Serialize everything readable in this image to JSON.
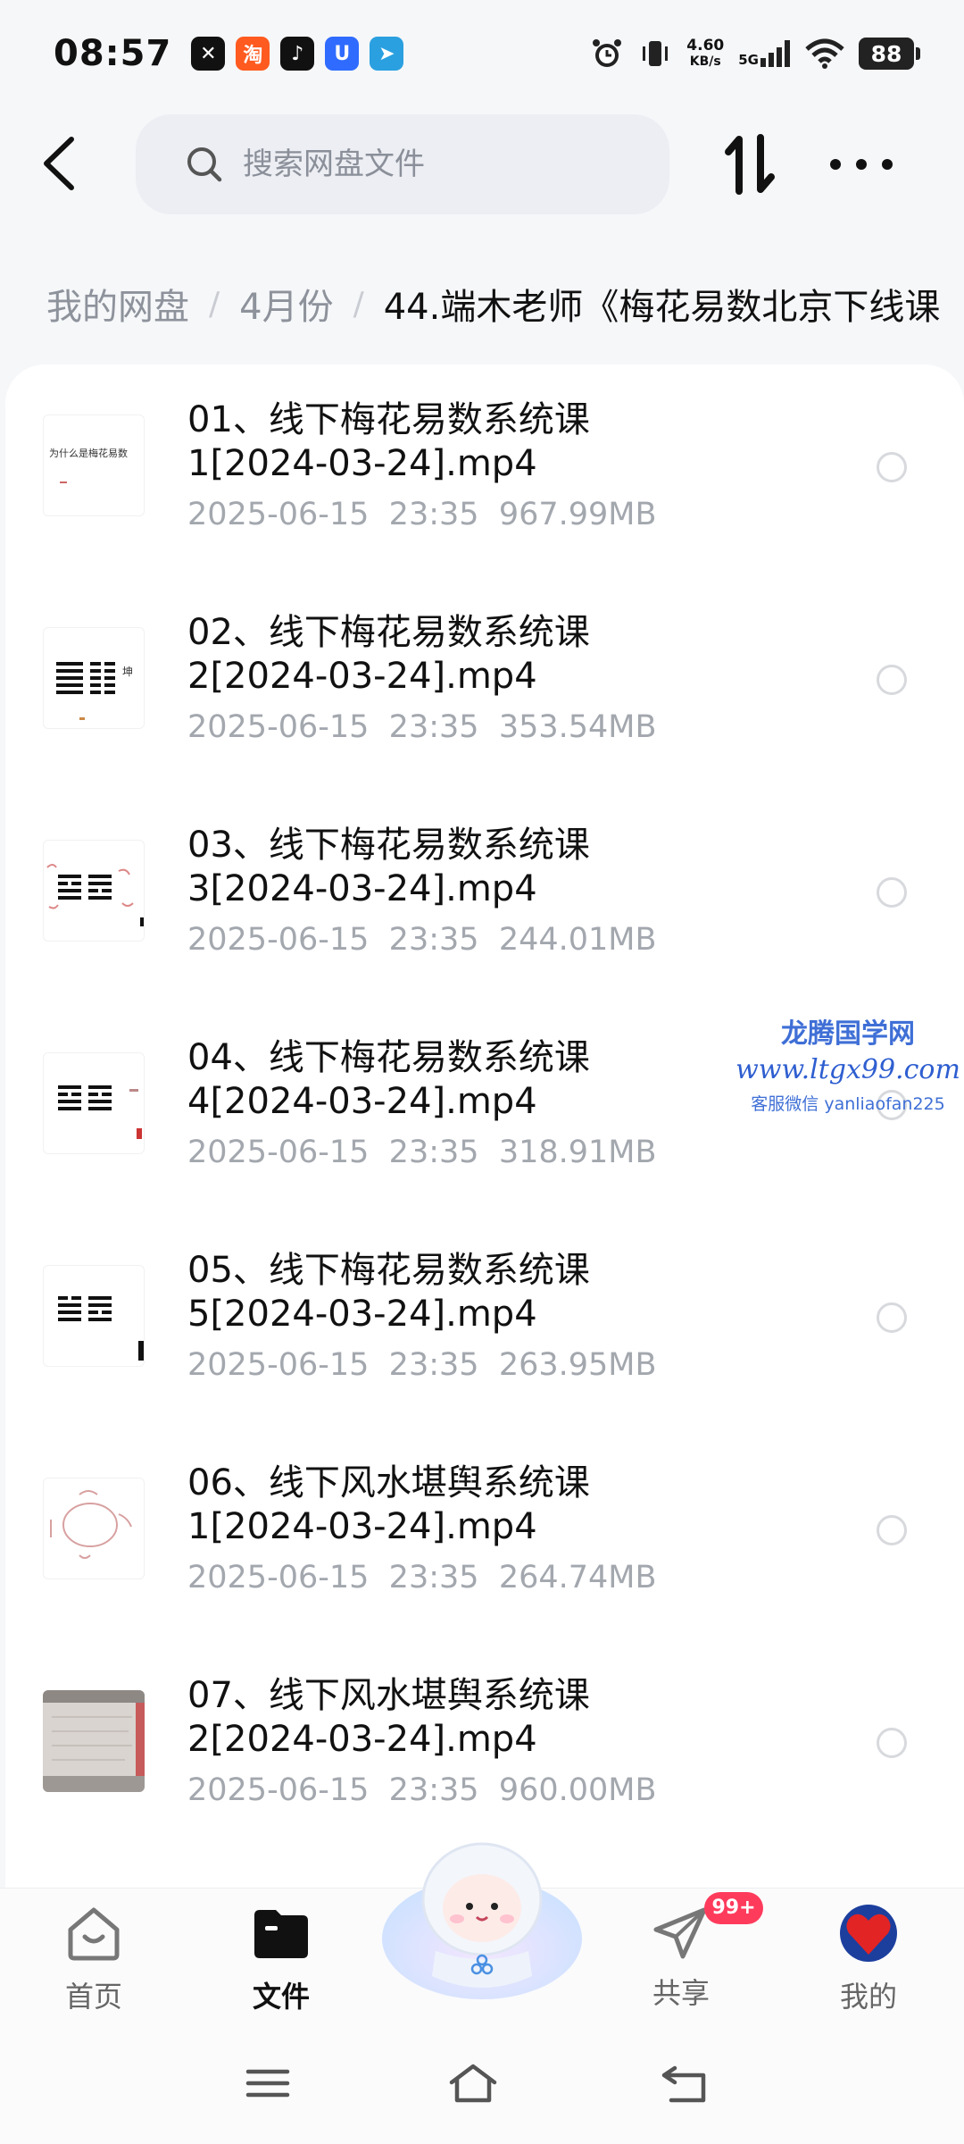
{
  "status_bar": {
    "time": "08:57",
    "net_speed_value": "4.60",
    "net_speed_unit": "KB/s",
    "network": "5G",
    "battery": "88"
  },
  "search": {
    "placeholder": "搜索网盘文件"
  },
  "breadcrumb": {
    "root": "我的网盘",
    "level1": "4月份",
    "current": "44.端木老师《梅花易数北京下线课"
  },
  "files": [
    {
      "name": "01、线下梅花易数系统课1[2024-03-24].mp4",
      "date": "2025-06-15",
      "time": "23:35",
      "size": "967.99MB",
      "thumb_text": "为什么是梅花易数"
    },
    {
      "name": "02、线下梅花易数系统课2[2024-03-24].mp4",
      "date": "2025-06-15",
      "time": "23:35",
      "size": "353.54MB",
      "thumb_text": "坤"
    },
    {
      "name": "03、线下梅花易数系统课3[2024-03-24].mp4",
      "date": "2025-06-15",
      "time": "23:35",
      "size": "244.01MB",
      "thumb_text": ""
    },
    {
      "name": "04、线下梅花易数系统课4[2024-03-24].mp4",
      "date": "2025-06-15",
      "time": "23:35",
      "size": "318.91MB",
      "thumb_text": ""
    },
    {
      "name": "05、线下梅花易数系统课5[2024-03-24].mp4",
      "date": "2025-06-15",
      "time": "23:35",
      "size": "263.95MB",
      "thumb_text": ""
    },
    {
      "name": "06、线下风水堪舆系统课1[2024-03-24].mp4",
      "date": "2025-06-15",
      "time": "23:35",
      "size": "264.74MB",
      "thumb_text": ""
    },
    {
      "name": "07、线下风水堪舆系统课2[2024-03-24].mp4",
      "date": "2025-06-15",
      "time": "23:35",
      "size": "960.00MB",
      "thumb_text": ""
    }
  ],
  "watermark": {
    "title": "龙腾国学网",
    "url": "www.ltgx99.com",
    "contact": "客服微信 yanliaofan225"
  },
  "bottom_nav": {
    "home": "首页",
    "files": "文件",
    "share": "共享",
    "share_badge": "99+",
    "mine": "我的"
  },
  "colors": {
    "accent_badge": "#ff3b5c",
    "watermark_blue": "#3f6fd6",
    "meta_grey": "#a3a7ae"
  }
}
